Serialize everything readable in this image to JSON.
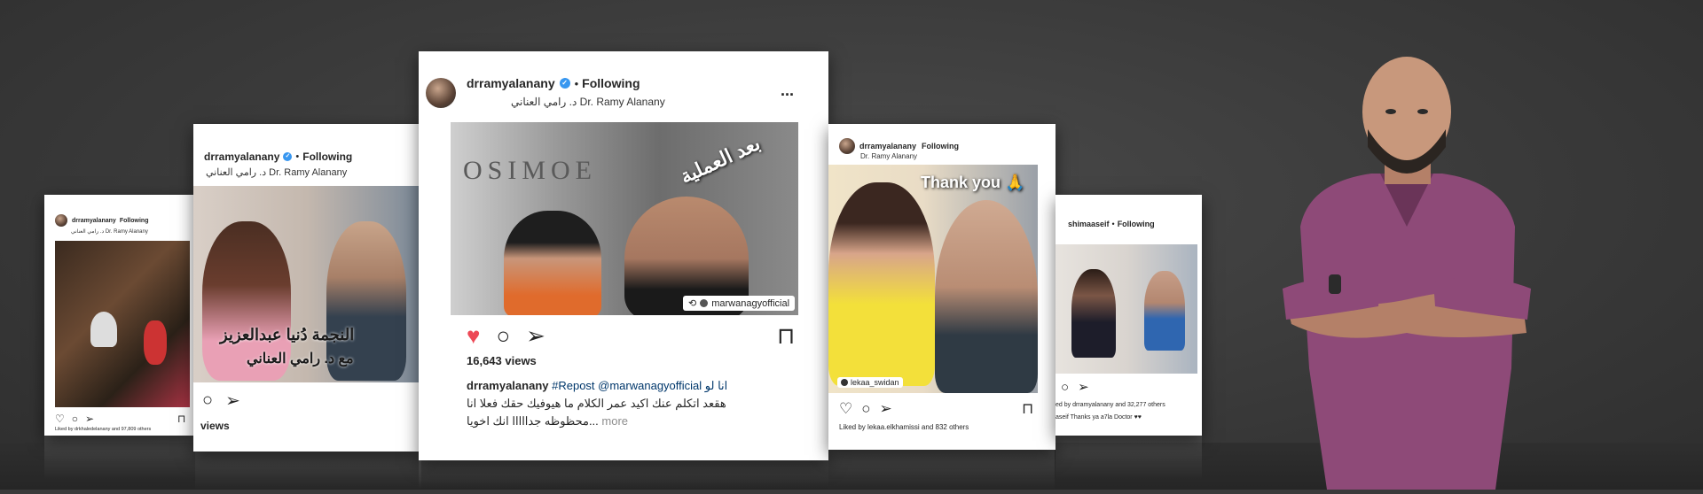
{
  "main_post": {
    "username": "drramyalanany",
    "separator": "•",
    "following": "Following",
    "display_name": "د. رامي العناني Dr. Ramy Alanany",
    "more": "...",
    "overlay_text": "بعد العملية",
    "repost_tag": "marwanagyofficial",
    "views": "16,643 views",
    "caption_user": "drramyalanany",
    "caption_line1": "#Repost @marwanagyofficial انا لو",
    "caption_line2": "هقعد اتكلم عنك اكيد عمر الكلام ما هيوفيك حقك فعلا انا",
    "caption_line3": "محظوظه جدااااا انك اخويا...",
    "caption_more": "more"
  },
  "left_post": {
    "username": "drramyalanany",
    "separator": "•",
    "following": "Following",
    "display_name": "د. رامي العناني Dr. Ramy Alanany",
    "overlay_line1": "النجمة دُنيا عبدالعزيز",
    "overlay_line2": "مع د. رامي العناني",
    "views": "views"
  },
  "far_left_post": {
    "username": "drramyalanany",
    "following": "Following",
    "display_name": "د. رامي العناني Dr. Ramy Alanany",
    "liked_by": "Liked by drkhaledelanany and 97,809 others"
  },
  "right_post": {
    "username": "drramyalanany",
    "following": "Following",
    "display_name": "Dr. Ramy Alanany",
    "overlay_text": "Thank you 🙏",
    "tag": "lekaa_swidan",
    "liked_by": "Liked by lekaa.elkhamissi and 832 others"
  },
  "far_right_post": {
    "username": "shimaaseif",
    "separator": "•",
    "following": "Following",
    "liked_by": "ed by drramyalanany and 32,277 others",
    "caption": "aseif Thanks ya a7la Doctor ♥♥"
  },
  "colors": {
    "background": "#3a3a3a",
    "verified": "#3897f0",
    "heart": "#ed4956",
    "scrubs": "#8e4a78"
  }
}
